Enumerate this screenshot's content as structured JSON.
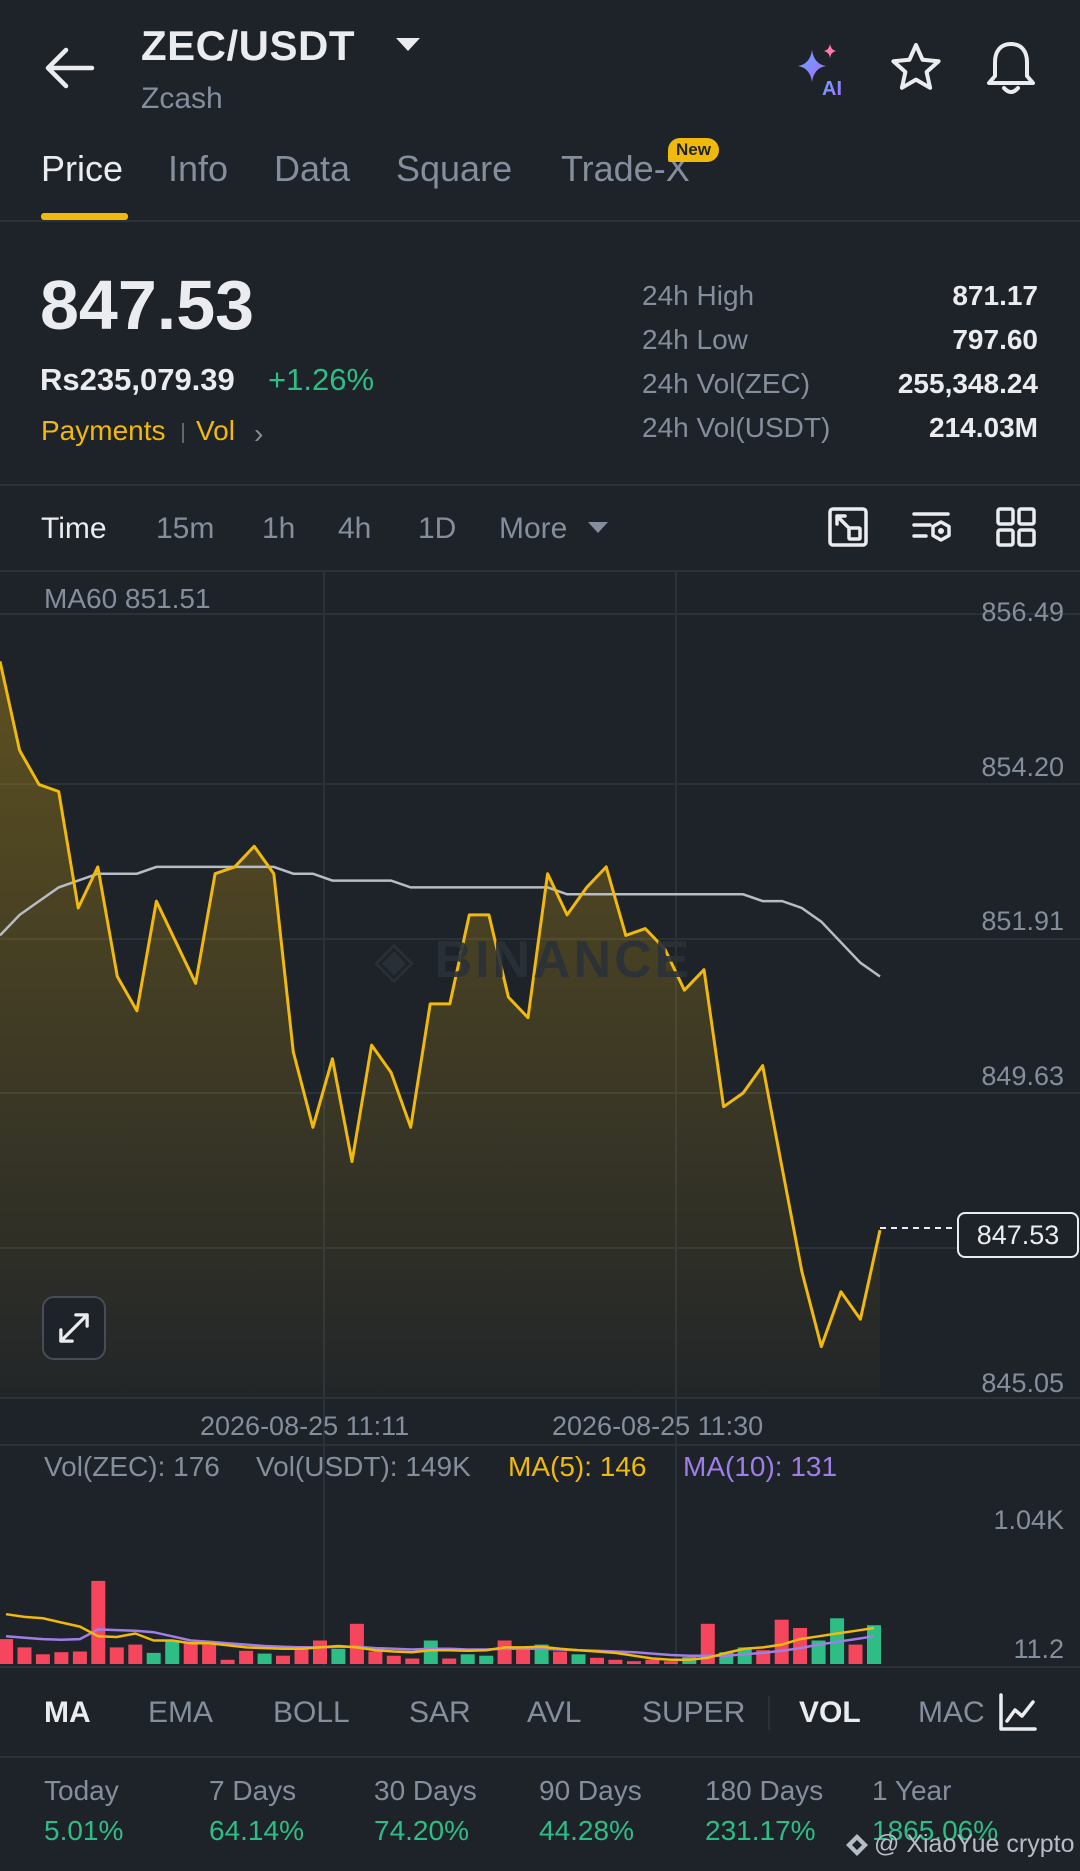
{
  "header": {
    "pair": "ZEC/USDT",
    "coin_name": "Zcash",
    "icons": [
      "back-arrow-icon",
      "ai-sparkle-icon",
      "star-icon",
      "bell-icon"
    ]
  },
  "tabs": [
    {
      "label": "Price",
      "active": true
    },
    {
      "label": "Info"
    },
    {
      "label": "Data"
    },
    {
      "label": "Square"
    },
    {
      "label": "Trade-X",
      "badge": "New"
    }
  ],
  "price": {
    "last": "847.53",
    "fiat": "Rs235,079.39",
    "change": "+1.26%",
    "tags": [
      "Payments",
      "Vol"
    ]
  },
  "stats": [
    {
      "label": "24h High",
      "value": "871.17"
    },
    {
      "label": "24h Low",
      "value": "797.60"
    },
    {
      "label": "24h Vol(ZEC)",
      "value": "255,348.24"
    },
    {
      "label": "24h Vol(USDT)",
      "value": "214.03M"
    }
  ],
  "intervals": [
    "Time",
    "15m",
    "1h",
    "4h",
    "1D",
    "More"
  ],
  "chart_tools": [
    "chart-mode-icon",
    "chart-settings-icon",
    "layout-grid-icon"
  ],
  "chart_data": {
    "type": "line",
    "ma_label": "MA60 851.51",
    "y_ticks": [
      "856.49",
      "854.20",
      "851.91",
      "849.63",
      "847.53",
      "845.05"
    ],
    "x_ticks": [
      "2026-08-25 11:11",
      "2026-08-25 11:30"
    ],
    "ylim": [
      845.05,
      856.49
    ],
    "current_price": 847.53,
    "series": [
      {
        "name": "Price",
        "values": [
          855.8,
          854.5,
          854.0,
          853.9,
          852.2,
          852.8,
          851.2,
          850.7,
          852.3,
          851.7,
          851.1,
          852.7,
          852.8,
          853.1,
          852.7,
          850.1,
          849.0,
          850.0,
          848.5,
          850.2,
          849.8,
          849.0,
          850.8,
          850.8,
          852.1,
          852.1,
          850.9,
          850.6,
          852.7,
          852.1,
          852.5,
          852.8,
          851.8,
          851.9,
          851.6,
          851.0,
          851.3,
          849.3,
          849.5,
          849.9,
          848.4,
          846.9,
          845.8,
          846.6,
          846.2,
          847.5
        ]
      },
      {
        "name": "MA60",
        "values": [
          851.8,
          852.1,
          852.3,
          852.5,
          852.6,
          852.7,
          852.7,
          852.7,
          852.8,
          852.8,
          852.8,
          852.8,
          852.8,
          852.8,
          852.8,
          852.7,
          852.7,
          852.6,
          852.6,
          852.6,
          852.6,
          852.5,
          852.5,
          852.5,
          852.5,
          852.5,
          852.5,
          852.5,
          852.5,
          852.4,
          852.4,
          852.4,
          852.4,
          852.4,
          852.4,
          852.4,
          852.4,
          852.4,
          852.4,
          852.3,
          852.3,
          852.2,
          852.0,
          851.7,
          851.4,
          851.2
        ]
      }
    ],
    "volume": {
      "legend": {
        "vol_zec": "Vol(ZEC): 176",
        "vol_usdt": "Vol(USDT): 149K",
        "ma5": "MA(5): 146",
        "ma10": "MA(10): 131"
      },
      "y_ticks": [
        "1.04K",
        "11.2"
      ],
      "ylim": [
        11.2,
        1040
      ],
      "bars": [
        {
          "v": 180,
          "up": false
        },
        {
          "v": 120,
          "up": false
        },
        {
          "v": 70,
          "up": false
        },
        {
          "v": 85,
          "up": false
        },
        {
          "v": 90,
          "up": false
        },
        {
          "v": 600,
          "up": false
        },
        {
          "v": 120,
          "up": false
        },
        {
          "v": 140,
          "up": false
        },
        {
          "v": 80,
          "up": true
        },
        {
          "v": 170,
          "up": true
        },
        {
          "v": 150,
          "up": false
        },
        {
          "v": 140,
          "up": false
        },
        {
          "v": 30,
          "up": false
        },
        {
          "v": 95,
          "up": false
        },
        {
          "v": 75,
          "up": true
        },
        {
          "v": 60,
          "up": false
        },
        {
          "v": 130,
          "up": false
        },
        {
          "v": 170,
          "up": false
        },
        {
          "v": 110,
          "up": true
        },
        {
          "v": 290,
          "up": false
        },
        {
          "v": 90,
          "up": false
        },
        {
          "v": 60,
          "up": false
        },
        {
          "v": 40,
          "up": false
        },
        {
          "v": 170,
          "up": true
        },
        {
          "v": 40,
          "up": false
        },
        {
          "v": 70,
          "up": true
        },
        {
          "v": 60,
          "up": true
        },
        {
          "v": 170,
          "up": false
        },
        {
          "v": 110,
          "up": false
        },
        {
          "v": 140,
          "up": true
        },
        {
          "v": 90,
          "up": false
        },
        {
          "v": 70,
          "up": true
        },
        {
          "v": 45,
          "up": false
        },
        {
          "v": 30,
          "up": false
        },
        {
          "v": 20,
          "up": false
        },
        {
          "v": 30,
          "up": false
        },
        {
          "v": 20,
          "up": false
        },
        {
          "v": 50,
          "up": true
        },
        {
          "v": 290,
          "up": false
        },
        {
          "v": 85,
          "up": true
        },
        {
          "v": 120,
          "up": true
        },
        {
          "v": 100,
          "up": false
        },
        {
          "v": 320,
          "up": false
        },
        {
          "v": 260,
          "up": false
        },
        {
          "v": 170,
          "up": true
        },
        {
          "v": 330,
          "up": true
        },
        {
          "v": 140,
          "up": false
        },
        {
          "v": 280,
          "up": true
        }
      ],
      "ma5": [
        360,
        340,
        330,
        300,
        270,
        200,
        195,
        220,
        170,
        170,
        150,
        150,
        135,
        120,
        115,
        110,
        110,
        120,
        130,
        120,
        100,
        90,
        85,
        100,
        100,
        95,
        100,
        120,
        120,
        125,
        110,
        100,
        90,
        80,
        60,
        40,
        30,
        30,
        45,
        80,
        110,
        120,
        140,
        180,
        200,
        220,
        240,
        260
      ],
      "ma10": [
        200,
        190,
        180,
        175,
        180,
        250,
        245,
        240,
        230,
        200,
        170,
        160,
        150,
        140,
        130,
        125,
        120,
        120,
        125,
        125,
        115,
        110,
        105,
        110,
        110,
        105,
        105,
        110,
        110,
        110,
        105,
        100,
        95,
        90,
        85,
        75,
        65,
        60,
        60,
        60,
        70,
        80,
        95,
        115,
        140,
        160,
        180,
        200
      ]
    }
  },
  "indicators": [
    {
      "label": "MA",
      "active": true
    },
    {
      "label": "EMA"
    },
    {
      "label": "BOLL"
    },
    {
      "label": "SAR"
    },
    {
      "label": "AVL"
    },
    {
      "label": "SUPER"
    },
    {
      "label": "VOL",
      "active": true
    },
    {
      "label": "MAC"
    }
  ],
  "performance": [
    {
      "label": "Today",
      "value": "5.01%"
    },
    {
      "label": "7 Days",
      "value": "64.14%"
    },
    {
      "label": "30 Days",
      "value": "74.20%"
    },
    {
      "label": "90 Days",
      "value": "44.28%"
    },
    {
      "label": "180 Days",
      "value": "231.17%"
    },
    {
      "label": "1 Year",
      "value": "1865.06%"
    }
  ],
  "credit": "@ XiaoYue crypto",
  "colors": {
    "background": "#1e2329",
    "accent": "#f0b90b",
    "up": "#2ebd85",
    "down": "#f6465d",
    "muted": "#848e9c",
    "ma10": "#9f7ee8"
  }
}
